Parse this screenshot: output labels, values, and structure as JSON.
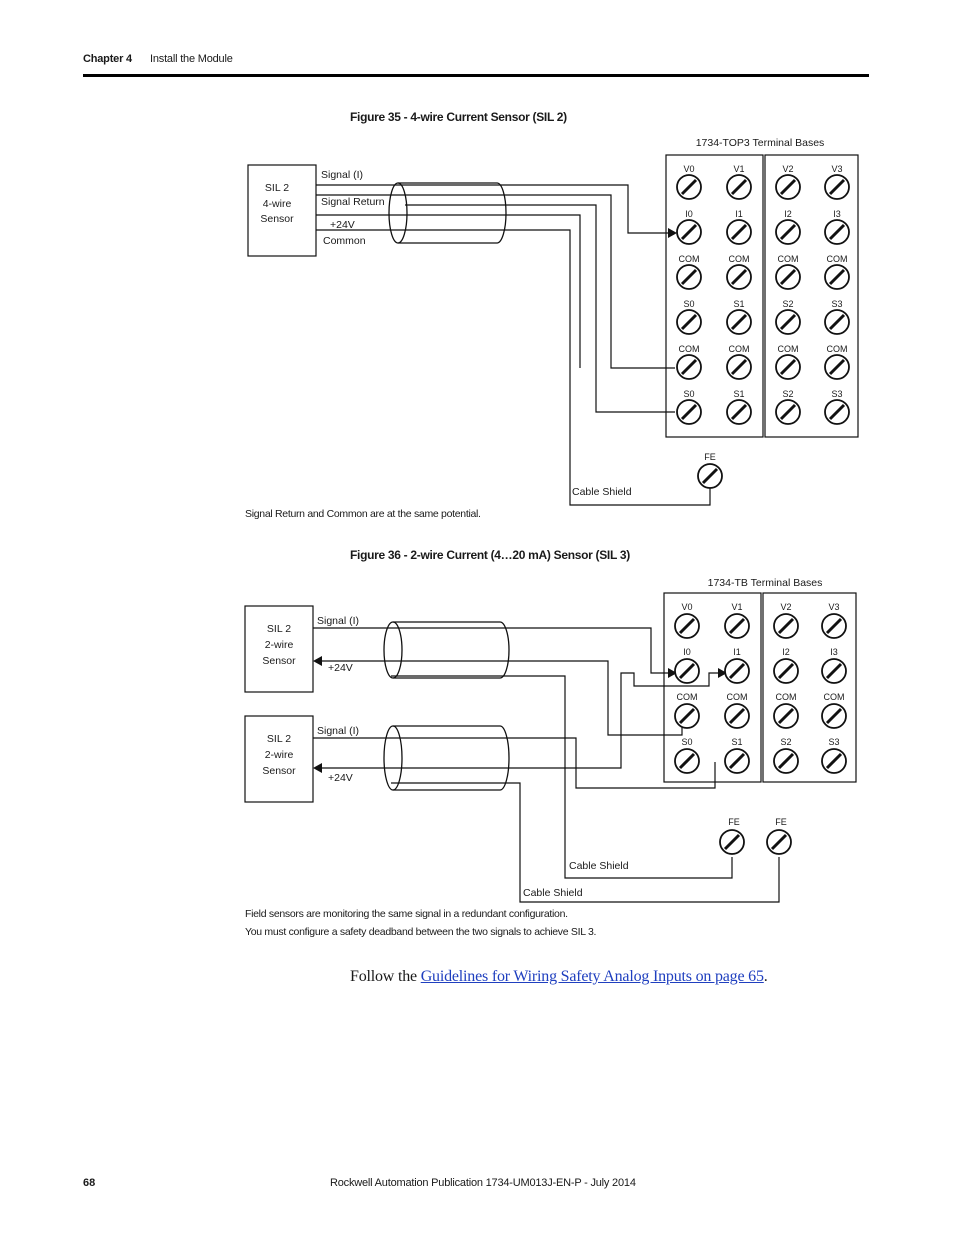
{
  "header": {
    "chapter": "Chapter 4",
    "title": "Install the Module"
  },
  "figure35": {
    "title": "Figure 35 - 4-wire Current Sensor (SIL 2)",
    "sensor": {
      "line1": "SIL 2",
      "line2": "4-wire",
      "line3": "Sensor"
    },
    "wires": [
      "Signal (I)",
      "Signal Return",
      "+24V",
      "Common"
    ],
    "terminal_base_label": "1734-TOP3 Terminal Bases",
    "rows": [
      [
        "V0",
        "V1",
        "V2",
        "V3"
      ],
      [
        "I0",
        "I1",
        "I2",
        "I3"
      ],
      [
        "COM",
        "COM",
        "COM",
        "COM"
      ],
      [
        "S0",
        "S1",
        "S2",
        "S3"
      ],
      [
        "COM",
        "COM",
        "COM",
        "COM"
      ],
      [
        "S0",
        "S1",
        "S2",
        "S3"
      ]
    ],
    "fe_label": "FE",
    "cable_shield": "Cable Shield",
    "note": "Signal Return and Common are at the same potential."
  },
  "figure36": {
    "title": "Figure 36 - 2-wire Current (4…20 mA) Sensor (SIL 3)",
    "sensors": [
      {
        "line1": "SIL 2",
        "line2": "2-wire",
        "line3": "Sensor",
        "signal": "Signal (I)",
        "power": "+24V"
      },
      {
        "line1": "SIL 2",
        "line2": "2-wire",
        "line3": "Sensor",
        "signal": "Signal (I)",
        "power": "+24V"
      }
    ],
    "terminal_base_label": "1734-TB Terminal Bases",
    "rows": [
      [
        "V0",
        "V1",
        "V2",
        "V3"
      ],
      [
        "I0",
        "I1",
        "I2",
        "I3"
      ],
      [
        "COM",
        "COM",
        "COM",
        "COM"
      ],
      [
        "S0",
        "S1",
        "S2",
        "S3"
      ]
    ],
    "fe_labels": [
      "FE",
      "FE"
    ],
    "cable_shields": [
      "Cable Shield",
      "Cable Shield"
    ],
    "notes": [
      "Field sensors are monitoring the same signal in a redundant configuration.",
      "You must configure a safety deadband between the two signals to achieve SIL 3."
    ]
  },
  "follow": {
    "prefix": "Follow the ",
    "link": "Guidelines for Wiring Safety Analog Inputs on page 65",
    "suffix": "."
  },
  "footer": {
    "page": "68",
    "publication": "Rockwell Automation Publication 1734-UM013J-EN-P - July 2014"
  }
}
